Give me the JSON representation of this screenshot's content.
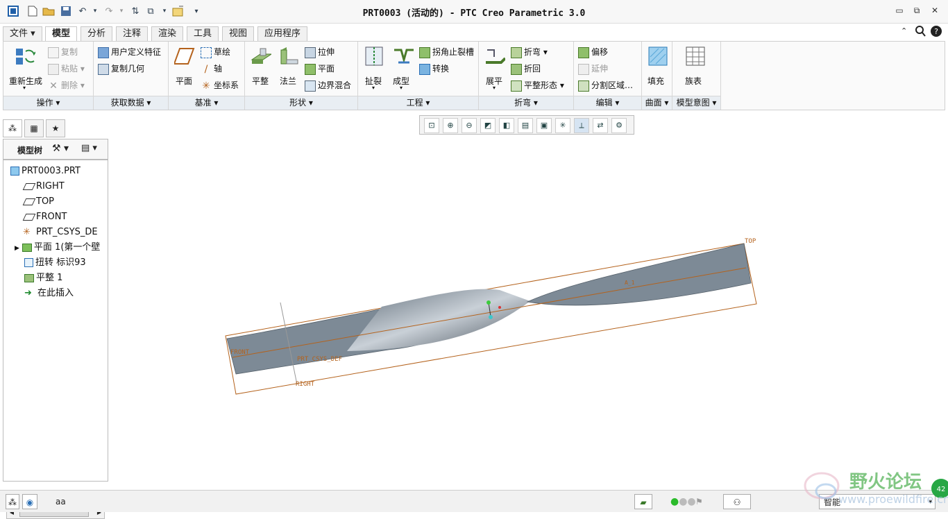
{
  "window": {
    "title": "PRT0003 (活动的) - PTC Creo Parametric 3.0"
  },
  "tabs": [
    {
      "label": "文件 ▾"
    },
    {
      "label": "模型"
    },
    {
      "label": "分析"
    },
    {
      "label": "注释"
    },
    {
      "label": "渲染"
    },
    {
      "label": "工具"
    },
    {
      "label": "视图"
    },
    {
      "label": "应用程序"
    }
  ],
  "ribbon": {
    "groups": {
      "operations": "操作 ▾",
      "get_data": "获取数据 ▾",
      "datum": "基准 ▾",
      "shapes": "形状 ▾",
      "engineering": "工程 ▾",
      "bends": "折弯 ▾",
      "editing": "编辑 ▾",
      "surfaces": "曲面 ▾",
      "model_intent": "模型意图 ▾"
    },
    "buttons": {
      "regenerate": "重新生成",
      "copy": "复制",
      "paste": "粘贴",
      "delete": "删除",
      "udf": "用户定义特征",
      "copy_geometry": "复制几何",
      "plane": "平面",
      "sketch": "草绘",
      "axis": "轴",
      "csys": "坐标系",
      "planar": "平整",
      "flange": "法兰",
      "extrude": "拉伸",
      "flat": "平面",
      "boundary_blend": "边界混合",
      "rip": "扯裂",
      "form": "成型",
      "corner_relief": "拐角止裂槽",
      "convert": "转换",
      "unbend": "展平",
      "bend": "折弯",
      "bend_back": "折回",
      "flat_state": "平整形态",
      "offset": "偏移",
      "extend": "延伸",
      "split_area": "分割区域…",
      "fill": "填充",
      "family_table": "族表"
    }
  },
  "model_tree": {
    "header": "模型树",
    "items": [
      {
        "label": "PRT0003.PRT"
      },
      {
        "label": "RIGHT"
      },
      {
        "label": "TOP"
      },
      {
        "label": "FRONT"
      },
      {
        "label": "PRT_CSYS_DE"
      },
      {
        "label": "平面 1(第一个壁"
      },
      {
        "label": "扭转 标识93"
      },
      {
        "label": "平整 1"
      },
      {
        "label": "在此插入"
      }
    ]
  },
  "graphics": {
    "labels": {
      "top": "TOP",
      "front": "FRONT",
      "right": "RIGHT",
      "csys": "PRT_CSYS_DEF",
      "axis": "A_1"
    }
  },
  "status": {
    "message": "aa",
    "filter": "智能"
  },
  "watermark": {
    "text": "野火论坛",
    "url": "www.proewildfire.cn",
    "badge": "42"
  },
  "colors": {
    "ribbon_bg": "#fafafa",
    "datum": "#b4621c",
    "sheet": "#7d8a96"
  }
}
